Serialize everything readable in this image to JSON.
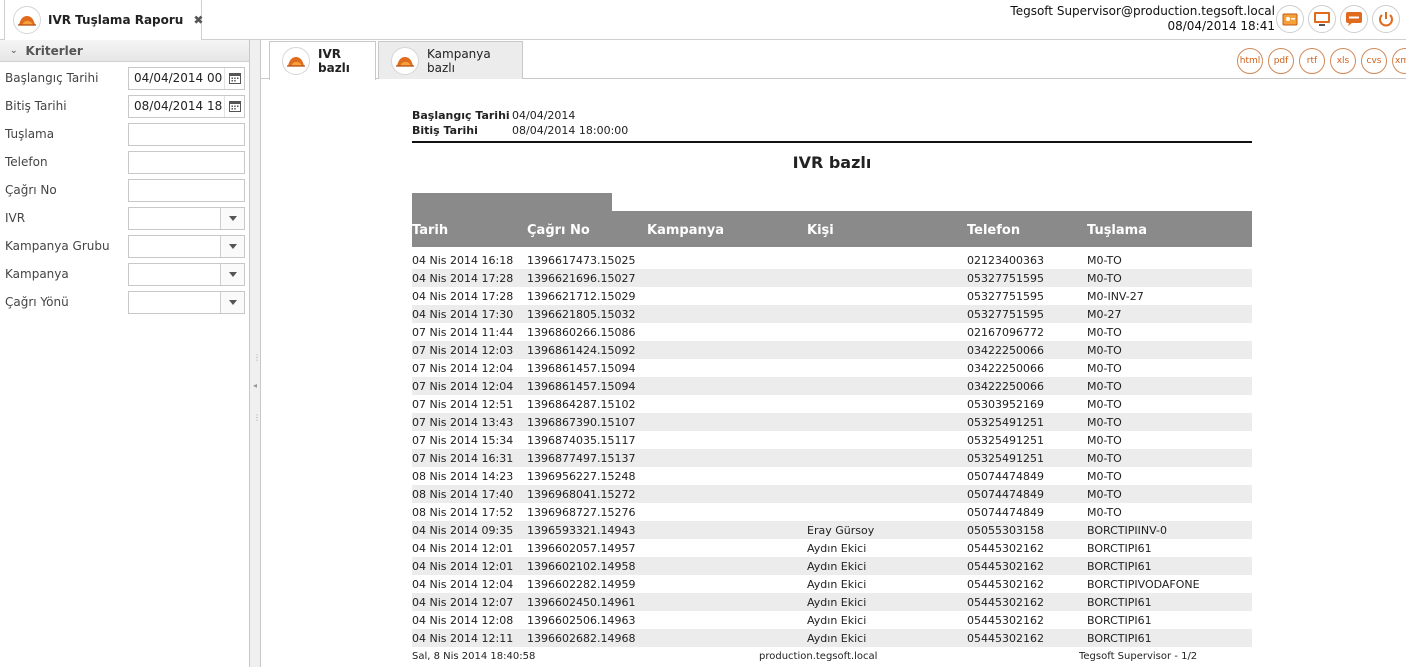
{
  "app_tab": {
    "title": "IVR Tuşlama Raporu",
    "close": "✖"
  },
  "user": {
    "name": "Tegsoft Supervisor@production.tegsoft.local",
    "datetime": "08/04/2014 18:41"
  },
  "top_icons": [
    "id-card-icon",
    "monitor-icon",
    "chat-icon",
    "power-icon"
  ],
  "left_panel": {
    "title": "Kriterler",
    "fields": [
      {
        "label": "Başlangıç Tarihi",
        "value": "04/04/2014 00"
      },
      {
        "label": "Bitiş Tarihi",
        "value": "08/04/2014 18"
      },
      {
        "label": "Tuşlama",
        "value": ""
      },
      {
        "label": "Telefon",
        "value": ""
      },
      {
        "label": "Çağrı No",
        "value": ""
      },
      {
        "label": "IVR",
        "value": ""
      },
      {
        "label": "Kampanya Grubu",
        "value": ""
      },
      {
        "label": "Kampanya",
        "value": ""
      },
      {
        "label": "Çağrı Yönü",
        "value": ""
      }
    ]
  },
  "tabs": [
    {
      "label": "IVR bazlı"
    },
    {
      "label": "Kampanya bazlı"
    }
  ],
  "exports": [
    "html",
    "pdf",
    "rtf",
    "xls",
    "cvs",
    "xm"
  ],
  "report": {
    "start_label": "Başlangıç Tarihi",
    "start_value": "04/04/2014",
    "end_label": "Bitiş Tarihi",
    "end_value": "08/04/2014 18:00:00",
    "title": "IVR bazlı",
    "columns": [
      "Tarih",
      "Çağrı No",
      "Kampanya",
      "Kişi",
      "Telefon",
      "Tuşlama"
    ],
    "rows": [
      [
        "04 Nis 2014 16:18",
        "1396617473.15025",
        "",
        "",
        "02123400363",
        "M0-TO"
      ],
      [
        "04 Nis 2014 17:28",
        "1396621696.15027",
        "",
        "",
        "05327751595",
        "M0-TO"
      ],
      [
        "04 Nis 2014 17:28",
        "1396621712.15029",
        "",
        "",
        "05327751595",
        "M0-INV-27"
      ],
      [
        "04 Nis 2014 17:30",
        "1396621805.15032",
        "",
        "",
        "05327751595",
        "M0-27"
      ],
      [
        "07 Nis 2014 11:44",
        "1396860266.15086",
        "",
        "",
        "02167096772",
        "M0-TO"
      ],
      [
        "07 Nis 2014 12:03",
        "1396861424.15092",
        "",
        "",
        "03422250066",
        "M0-TO"
      ],
      [
        "07 Nis 2014 12:04",
        "1396861457.15094",
        "",
        "",
        "03422250066",
        "M0-TO"
      ],
      [
        "07 Nis 2014 12:04",
        "1396861457.15094",
        "",
        "",
        "03422250066",
        "M0-TO"
      ],
      [
        "07 Nis 2014 12:51",
        "1396864287.15102",
        "",
        "",
        "05303952169",
        "M0-TO"
      ],
      [
        "07 Nis 2014 13:43",
        "1396867390.15107",
        "",
        "",
        "05325491251",
        "M0-TO"
      ],
      [
        "07 Nis 2014 15:34",
        "1396874035.15117",
        "",
        "",
        "05325491251",
        "M0-TO"
      ],
      [
        "07 Nis 2014 16:31",
        "1396877497.15137",
        "",
        "",
        "05325491251",
        "M0-TO"
      ],
      [
        "08 Nis 2014 14:23",
        "1396956227.15248",
        "",
        "",
        "05074474849",
        "M0-TO"
      ],
      [
        "08 Nis 2014 17:40",
        "1396968041.15272",
        "",
        "",
        "05074474849",
        "M0-TO"
      ],
      [
        "08 Nis 2014 17:52",
        "1396968727.15276",
        "",
        "",
        "05074474849",
        "M0-TO"
      ],
      [
        "04 Nis 2014 09:35",
        "1396593321.14943",
        "",
        "Eray Gürsoy",
        "05055303158",
        "BORCTIPIINV-0"
      ],
      [
        "04 Nis 2014 12:01",
        "1396602057.14957",
        "",
        "Aydın Ekici",
        "05445302162",
        "BORCTIPI61"
      ],
      [
        "04 Nis 2014 12:01",
        "1396602102.14958",
        "",
        "Aydın Ekici",
        "05445302162",
        "BORCTIPI61"
      ],
      [
        "04 Nis 2014 12:04",
        "1396602282.14959",
        "",
        "Aydın Ekici",
        "05445302162",
        "BORCTIPIVODAFONE"
      ],
      [
        "04 Nis 2014 12:07",
        "1396602450.14961",
        "",
        "Aydın Ekici",
        "05445302162",
        "BORCTIPI61"
      ],
      [
        "04 Nis 2014 12:08",
        "1396602506.14963",
        "",
        "Aydın Ekici",
        "05445302162",
        "BORCTIPI61"
      ],
      [
        "04 Nis 2014 12:11",
        "1396602682.14968",
        "",
        "Aydın Ekici",
        "05445302162",
        "BORCTIPI61"
      ]
    ],
    "footer": {
      "left": "Sal, 8 Nis 2014 18:40:58",
      "center": "production.tegsoft.local",
      "right": "Tegsoft Supervisor - 1/2"
    }
  },
  "colors": {
    "accent": "#e06b1d",
    "header_gray": "#8a8a8a",
    "row_alt": "#ececec"
  }
}
